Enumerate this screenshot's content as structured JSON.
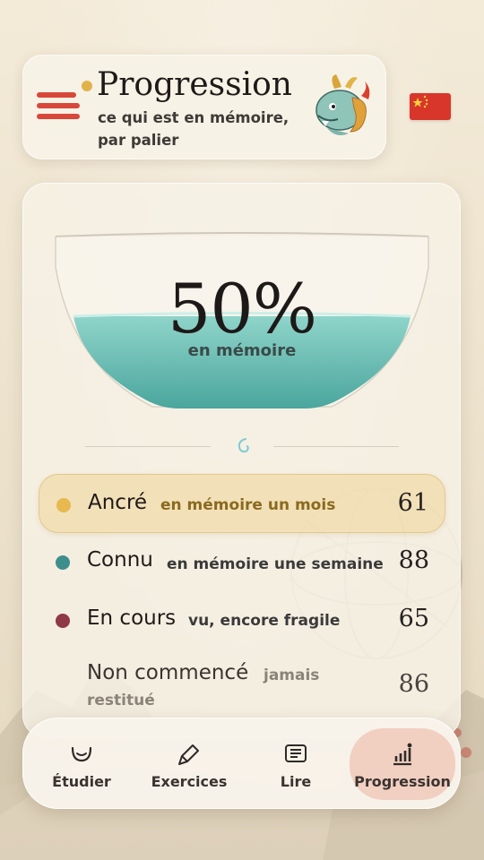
{
  "header": {
    "title": "Progression",
    "subtitle": "ce qui est en mémoire, par palier",
    "menu_icon": "hamburger-menu-icon",
    "mascot_icon": "dragon-icon",
    "language_flag": "china-flag-icon"
  },
  "summary": {
    "percent_label": "50%",
    "percent_value": 50,
    "caption": "en mémoire"
  },
  "tiers": [
    {
      "name": "Ancré",
      "description": "en mémoire un mois",
      "count": "61",
      "color": "#e7b94f"
    },
    {
      "name": "Connu",
      "description": "en mémoire une semaine",
      "count": "88",
      "color": "#3e8f8c"
    },
    {
      "name": "En cours",
      "description": "vu, encore fragile",
      "count": "65",
      "color": "#8f3846"
    },
    {
      "name": "Non commencé",
      "description": "jamais restitué",
      "count": "86",
      "color": ""
    }
  ],
  "nav": [
    {
      "label": "Étudier",
      "icon": "smile-bowl-icon"
    },
    {
      "label": "Exercices",
      "icon": "brush-icon"
    },
    {
      "label": "Lire",
      "icon": "newspaper-icon"
    },
    {
      "label": "Progression",
      "icon": "bar-chart-icon",
      "active": true
    }
  ],
  "colors": {
    "accent_red": "#d8473a",
    "water_teal": "#6dc4bb",
    "active_nav": "#f1cfc1"
  }
}
